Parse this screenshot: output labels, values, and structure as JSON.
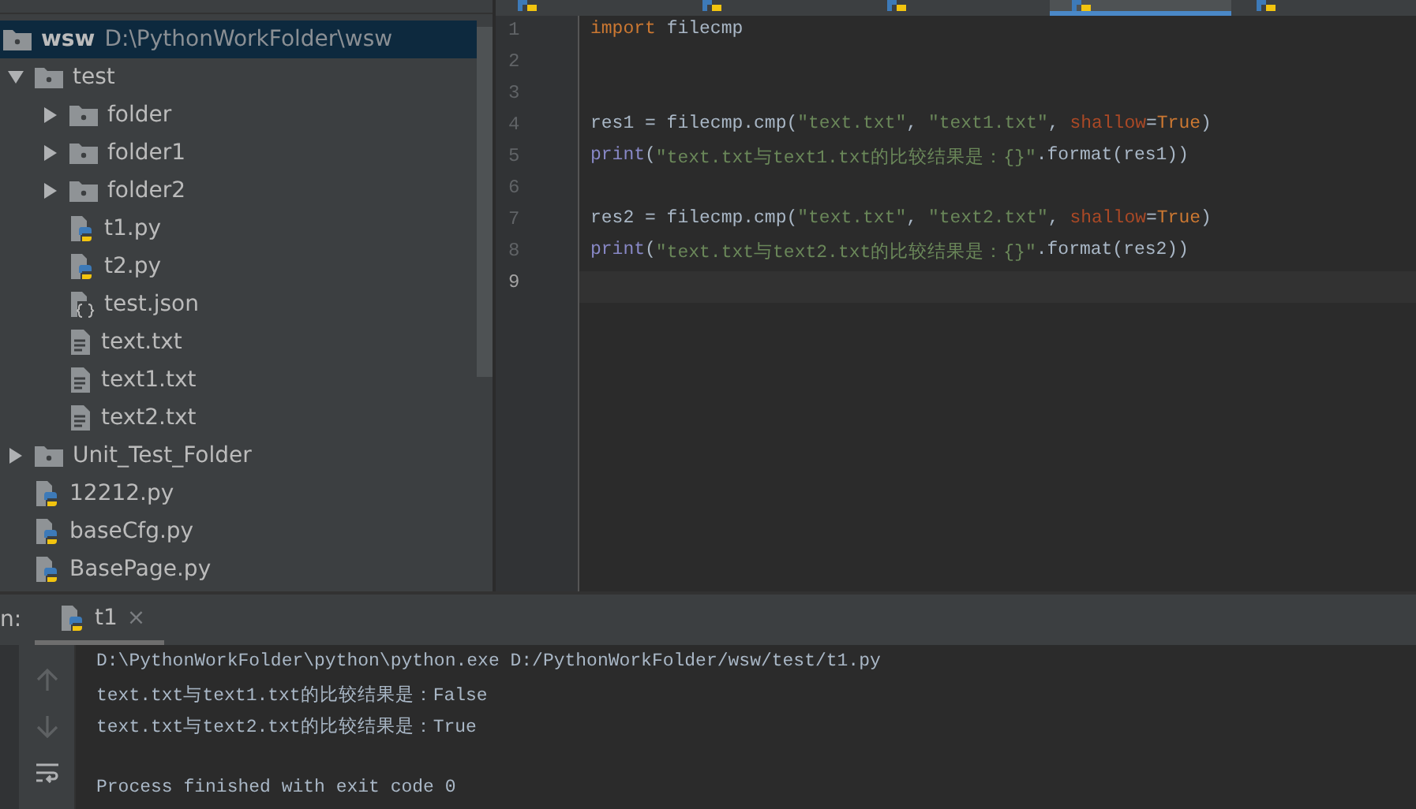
{
  "project_tree": {
    "items": [
      {
        "name": "wsw",
        "path": "D:\\PythonWorkFolder\\wsw",
        "kind": "folder",
        "selected": true,
        "children": [
          {
            "name": "test",
            "kind": "folder",
            "expanded": true,
            "selected": false,
            "children": [
              {
                "name": "folder",
                "kind": "folder",
                "expanded": false,
                "selected": false
              },
              {
                "name": "folder1",
                "kind": "folder",
                "expanded": false,
                "selected": false
              },
              {
                "name": "folder2",
                "kind": "folder",
                "expanded": false,
                "selected": false
              },
              {
                "name": "t1.py",
                "kind": "python",
                "selected": false
              },
              {
                "name": "t2.py",
                "kind": "python",
                "selected": false
              },
              {
                "name": "test.json",
                "kind": "json",
                "selected": false
              },
              {
                "name": "text.txt",
                "kind": "text",
                "selected": false
              },
              {
                "name": "text1.txt",
                "kind": "text",
                "selected": false
              },
              {
                "name": "text2.txt",
                "kind": "text",
                "selected": false
              }
            ]
          },
          {
            "name": "Unit_Test_Folder",
            "kind": "folder",
            "expanded": false,
            "selected": false
          },
          {
            "name": "12212.py",
            "kind": "python",
            "selected": false
          },
          {
            "name": "baseCfg.py",
            "kind": "python",
            "selected": false
          },
          {
            "name": "BasePage.py",
            "kind": "python",
            "selected": false
          }
        ]
      }
    ]
  },
  "editor": {
    "tabs": [
      {
        "selected": false
      },
      {
        "selected": false
      },
      {
        "selected": false
      },
      {
        "selected": true
      },
      {
        "selected": false
      }
    ],
    "lines": [
      {
        "number": "1",
        "current": false,
        "tokens": [
          {
            "kind": "keyword",
            "text": "import"
          },
          {
            "kind": "plain",
            "text": " filecmp"
          }
        ]
      },
      {
        "number": "2",
        "current": false
      },
      {
        "number": "3",
        "current": false
      },
      {
        "number": "4",
        "current": false,
        "tokens": [
          {
            "kind": "plain",
            "text": "res1 = filecmp.cmp("
          },
          {
            "kind": "string",
            "text": "\"text.txt\""
          },
          {
            "kind": "plain",
            "text": ", "
          },
          {
            "kind": "string",
            "text": "\"text1.txt\""
          },
          {
            "kind": "plain",
            "text": ", "
          },
          {
            "kind": "param",
            "text": "shallow"
          },
          {
            "kind": "plain",
            "text": "="
          },
          {
            "kind": "keyword",
            "text": "True"
          },
          {
            "kind": "plain",
            "text": ")"
          }
        ]
      },
      {
        "number": "5",
        "current": false,
        "tokens": [
          {
            "kind": "builtin",
            "text": "print"
          },
          {
            "kind": "plain",
            "text": "("
          },
          {
            "kind": "string",
            "text": "\"text.txt与text1.txt的比较结果是：{}\""
          },
          {
            "kind": "plain",
            "text": ".format(res1))"
          }
        ]
      },
      {
        "number": "6",
        "current": false
      },
      {
        "number": "7",
        "current": false,
        "tokens": [
          {
            "kind": "plain",
            "text": "res2 = filecmp.cmp("
          },
          {
            "kind": "string",
            "text": "\"text.txt\""
          },
          {
            "kind": "plain",
            "text": ", "
          },
          {
            "kind": "string",
            "text": "\"text2.txt\""
          },
          {
            "kind": "plain",
            "text": ", "
          },
          {
            "kind": "param",
            "text": "shallow"
          },
          {
            "kind": "plain",
            "text": "="
          },
          {
            "kind": "keyword",
            "text": "True"
          },
          {
            "kind": "plain",
            "text": ")"
          }
        ]
      },
      {
        "number": "8",
        "current": false,
        "tokens": [
          {
            "kind": "builtin",
            "text": "print"
          },
          {
            "kind": "plain",
            "text": "("
          },
          {
            "kind": "string",
            "text": "\"text.txt与text2.txt的比较结果是：{}\""
          },
          {
            "kind": "plain",
            "text": ".format(res2))"
          }
        ]
      },
      {
        "number": "9",
        "current": true
      }
    ]
  },
  "run_panel": {
    "label": "n:",
    "tabs": [
      {
        "label": "t1",
        "close": "×",
        "selected": true
      }
    ],
    "console": [
      {
        "kind": "command",
        "text": "D:\\PythonWorkFolder\\python\\python.exe D:/PythonWorkFolder/wsw/test/t1.py"
      },
      {
        "kind": "output",
        "text": "text.txt与text1.txt的比较结果是：False"
      },
      {
        "kind": "output",
        "text": "text.txt与text2.txt的比较结果是：True"
      },
      {
        "kind": "exit",
        "text": "Process finished with exit code 0"
      }
    ]
  }
}
